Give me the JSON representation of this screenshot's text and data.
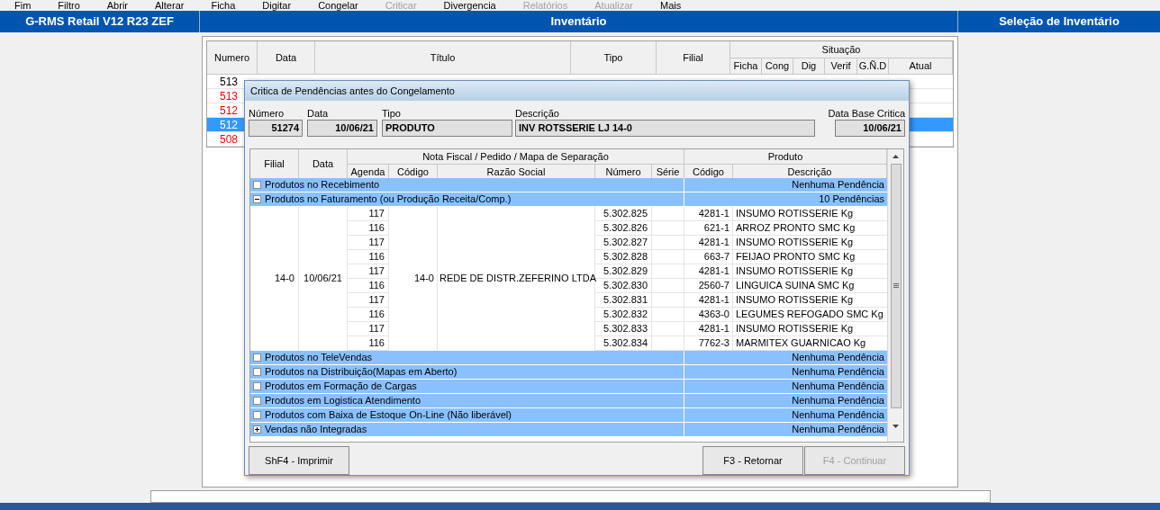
{
  "menu": [
    {
      "label": "Fim",
      "disabled": false
    },
    {
      "label": "Filtro",
      "disabled": false
    },
    {
      "label": "Abrir",
      "disabled": false
    },
    {
      "label": "Alterar",
      "disabled": false
    },
    {
      "label": "Ficha",
      "disabled": false
    },
    {
      "label": "Digitar",
      "disabled": false
    },
    {
      "label": "Congelar",
      "disabled": false
    },
    {
      "label": "Criticar",
      "disabled": true
    },
    {
      "label": "Divergencia",
      "disabled": false
    },
    {
      "label": "Relatórios",
      "disabled": true
    },
    {
      "label": "Atualizar",
      "disabled": true
    },
    {
      "label": "Mais",
      "disabled": false
    }
  ],
  "title_bar": {
    "left": "G-RMS Retail V12 R23 ZEF",
    "center": "Inventário",
    "right": "Seleção de Inventário"
  },
  "grid": {
    "columns": [
      "Numero",
      "Data",
      "Título",
      "Tipo",
      "Filial"
    ],
    "group_header": "Situação",
    "sub_columns": [
      "Ficha",
      "Cong",
      "Dig",
      "Verif",
      "G.Ñ.D",
      "Atual"
    ],
    "rows": [
      {
        "numero": "513",
        "alert": false,
        "selected": false
      },
      {
        "numero": "513",
        "alert": true,
        "selected": false
      },
      {
        "numero": "512",
        "alert": true,
        "selected": false
      },
      {
        "numero": "512",
        "selected": true
      },
      {
        "numero": "508",
        "alert": true,
        "selected": false
      }
    ]
  },
  "dialog": {
    "title": "Critica de Pendências antes do Congelamento",
    "fields": [
      {
        "label": "Número",
        "value": "51274"
      },
      {
        "label": "Data",
        "value": "10/06/21"
      },
      {
        "label": "Tipo",
        "value": "PRODUTO"
      },
      {
        "label": "Descrição",
        "value": "INV ROTSSERIE LJ 14-0"
      },
      {
        "label": "Data Base Critica",
        "value": "10/06/21"
      }
    ],
    "table": {
      "col_filial": "Filial",
      "col_data": "Data",
      "group_nota": "Nota Fiscal / Pedido / Mapa de Separação",
      "group_produto": "Produto",
      "sub_nota": [
        "Agenda",
        "Código",
        "Razão Social",
        "Número",
        "Série"
      ],
      "sub_produto": [
        "Código",
        "Descrição"
      ],
      "groups": [
        {
          "label": "Produtos no Recebimento",
          "status": "Nenhuma Pendência",
          "kind": "empty"
        },
        {
          "label": "Produtos no Faturamento (ou Produção Receita/Comp.)",
          "status": "10 Pendências",
          "kind": "open",
          "merged": {
            "filial": "14-0",
            "data": "10/06/21",
            "codigo": "14-0",
            "razao": "REDE DE DISTR.ZEFERINO LTDA"
          },
          "rows": [
            {
              "agenda": "117",
              "numero": "5.302.825",
              "codigo": "4281-1",
              "descricao": "INSUMO ROTISSERIE Kg"
            },
            {
              "agenda": "116",
              "numero": "5.302.826",
              "codigo": "621-1",
              "descricao": "ARROZ PRONTO SMC Kg"
            },
            {
              "agenda": "117",
              "numero": "5.302.827",
              "codigo": "4281-1",
              "descricao": "INSUMO ROTISSERIE Kg"
            },
            {
              "agenda": "116",
              "numero": "5.302.828",
              "codigo": "663-7",
              "descricao": "FEIJAO PRONTO SMC Kg"
            },
            {
              "agenda": "117",
              "numero": "5.302.829",
              "codigo": "4281-1",
              "descricao": "INSUMO ROTISSERIE Kg"
            },
            {
              "agenda": "116",
              "numero": "5.302.830",
              "codigo": "2560-7",
              "descricao": "LINGUICA SUINA SMC Kg"
            },
            {
              "agenda": "117",
              "numero": "5.302.831",
              "codigo": "4281-1",
              "descricao": "INSUMO ROTISSERIE Kg"
            },
            {
              "agenda": "116",
              "numero": "5.302.832",
              "codigo": "4363-0",
              "descricao": "LEGUMES REFOGADO SMC Kg"
            },
            {
              "agenda": "117",
              "numero": "5.302.833",
              "codigo": "4281-1",
              "descricao": "INSUMO ROTISSERIE Kg"
            },
            {
              "agenda": "116",
              "numero": "5.302.834",
              "codigo": "7762-3",
              "descricao": "MARMITEX GUARNICAO Kg"
            }
          ]
        },
        {
          "label": "Produtos no TeleVendas",
          "status": "Nenhuma Pendência",
          "kind": "empty"
        },
        {
          "label": "Produtos na Distribuição(Mapas em Aberto)",
          "status": "Nenhuma Pendência",
          "kind": "empty"
        },
        {
          "label": "Produtos em Formação de Cargas",
          "status": "Nenhuma Pendência",
          "kind": "empty"
        },
        {
          "label": "Produtos em Logistica Atendimento",
          "status": "Nenhuma Pendência",
          "kind": "empty"
        },
        {
          "label": "Produtos com Baixa de Estoque On-Line (Não liberável)",
          "status": "Nenhuma Pendência",
          "kind": "empty"
        },
        {
          "label": "Vendas não Integradas",
          "status": "Nenhuma Pendência",
          "kind": "closed"
        }
      ]
    },
    "buttons": [
      {
        "label": "ShF4 - Imprimir",
        "disabled": false
      },
      {
        "label": "F3 - Retornar",
        "disabled": false
      },
      {
        "label": "F4 - Continuar",
        "disabled": true
      }
    ]
  }
}
